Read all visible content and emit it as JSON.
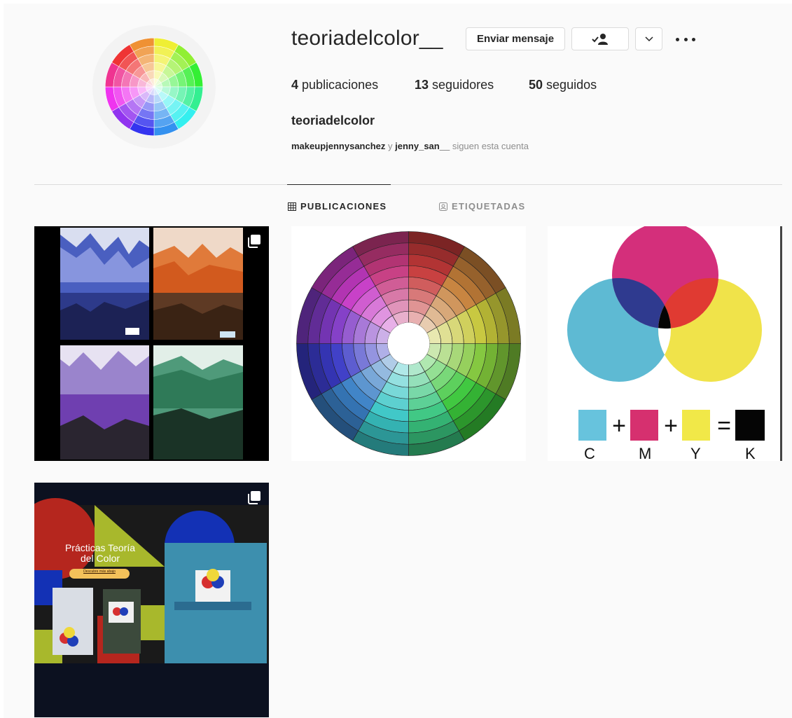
{
  "profile": {
    "username": "teoriadelcolor__",
    "full_name": "teoriadelcolor",
    "avatar_icon": "color-wheel-avatar"
  },
  "actions": {
    "message_label": "Enviar mensaje",
    "following_icon": "person-check-icon",
    "dropdown_icon": "chevron-down-icon",
    "more_icon": "more-options-icon"
  },
  "stats": {
    "posts_count": "4",
    "posts_label": "publicaciones",
    "followers_count": "13",
    "followers_label": "seguidores",
    "following_count": "50",
    "following_label": "seguidos"
  },
  "followed_by": {
    "user1": "makeupjennysanchez",
    "connector": "y",
    "user2": "jenny_san__",
    "suffix": "siguen esta cuenta"
  },
  "tabs": [
    {
      "label": "PUBLICACIONES",
      "icon": "grid-icon",
      "active": true
    },
    {
      "label": "ETIQUETADAS",
      "icon": "tag-user-icon",
      "active": false
    }
  ],
  "posts": [
    {
      "name": "landscape-paintings",
      "multi": true
    },
    {
      "name": "color-wheel-chart",
      "multi": false
    },
    {
      "name": "cmyk-diagram",
      "multi": false,
      "labels": [
        "C",
        "M",
        "Y",
        "K"
      ]
    },
    {
      "name": "practicas-teoria-color",
      "multi": true,
      "title": "Prácticas Teoría del Color",
      "button_text": "Descubre más abajo"
    }
  ],
  "colors": {
    "background": "#fafafa",
    "text": "#262626",
    "muted": "#8e8e8e",
    "border": "#dbdbdb"
  }
}
